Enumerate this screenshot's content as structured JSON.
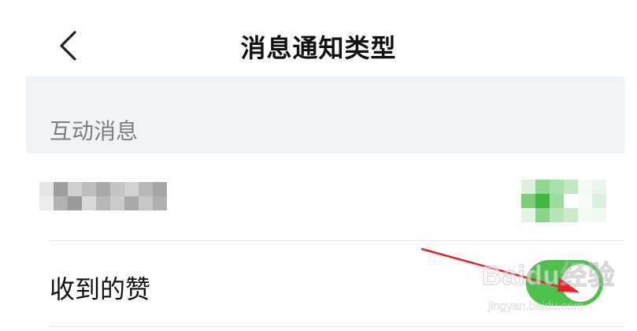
{
  "header": {
    "title": "消息通知类型",
    "back_icon": "chevron-left-icon"
  },
  "section": {
    "title": "互动消息"
  },
  "rows": [
    {
      "label": "",
      "label_obscured": true,
      "toggle_on": true,
      "toggle_obscured": true
    },
    {
      "label": "收到的赞",
      "toggle_on": true
    }
  ],
  "colors": {
    "toggle_on": "#4cc14c",
    "section_bg": "#f1f4f7",
    "annotation_arrow": "#e8202a"
  },
  "watermark": {
    "logo": "Baidu经验",
    "url": "jingyan.baidu.com"
  }
}
